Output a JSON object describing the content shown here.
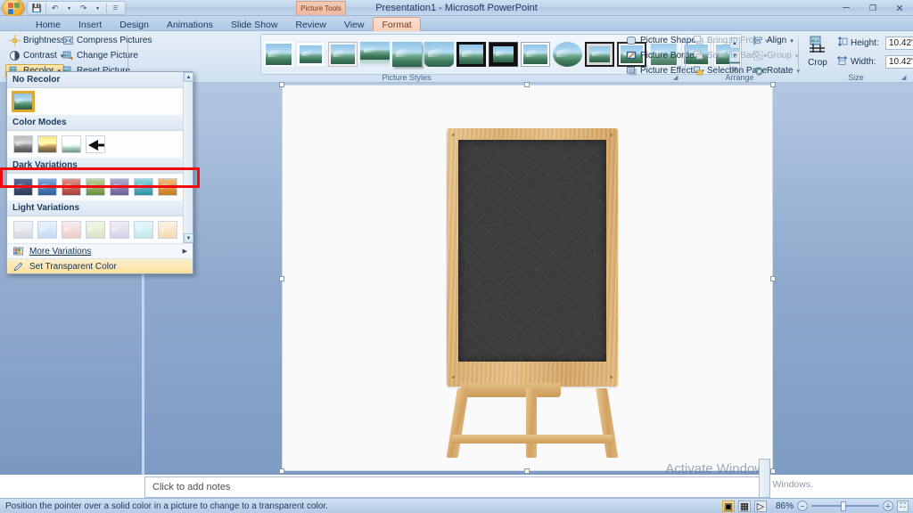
{
  "window": {
    "title": "Presentation1  -  Microsoft PowerPoint",
    "contextual_tab_banner": "Picture Tools",
    "minimize": "─",
    "restore": "❐",
    "close": "✕"
  },
  "quick_access": {
    "office_button": "office-orb",
    "items": [
      {
        "name": "save",
        "glyph": "💾"
      },
      {
        "name": "undo",
        "glyph": "↶"
      },
      {
        "name": "undo-dropdown",
        "glyph": "▾"
      },
      {
        "name": "redo",
        "glyph": "↷"
      },
      {
        "name": "redo-dropdown",
        "glyph": "▾"
      },
      {
        "name": "customize",
        "glyph": "☰"
      }
    ]
  },
  "tabs": [
    {
      "label": "Home",
      "active": false
    },
    {
      "label": "Insert",
      "active": false
    },
    {
      "label": "Design",
      "active": false
    },
    {
      "label": "Animations",
      "active": false
    },
    {
      "label": "Slide Show",
      "active": false
    },
    {
      "label": "Review",
      "active": false
    },
    {
      "label": "View",
      "active": false
    },
    {
      "label": "Format",
      "active": true
    }
  ],
  "ribbon": {
    "groups": [
      {
        "name": "adjust",
        "label": ""
      },
      {
        "name": "picture-styles",
        "label": "Picture Styles"
      },
      {
        "name": "arrange",
        "label": "Arrange"
      },
      {
        "name": "size",
        "label": "Size"
      }
    ],
    "adjust": {
      "brightness": "Brightness",
      "contrast": "Contrast",
      "recolor": "Recolor",
      "compress_pictures": "Compress Pictures",
      "change_picture": "Change Picture",
      "reset_picture": "Reset Picture"
    },
    "picture_styles": {
      "shape": "Picture Shape",
      "border": "Picture Border",
      "effects": "Picture Effects",
      "thumb_count": 15
    },
    "arrange": {
      "bring_to_front": "Bring to Front",
      "send_to_back": "Send to Back",
      "selection_pane": "Selection Pane",
      "align": "Align",
      "group": "Group",
      "rotate": "Rotate"
    },
    "size": {
      "crop": "Crop",
      "height_label": "Height:",
      "height_value": "10.42\"",
      "width_label": "Width:",
      "width_value": "10.42\""
    }
  },
  "recolor_menu": {
    "sections": [
      {
        "heading": "No Recolor",
        "swatches": 1,
        "selected_index": 0,
        "kind": "none"
      },
      {
        "heading": "Color Modes",
        "swatches": 4,
        "selected_index": -1,
        "kind": "modes"
      },
      {
        "heading": "Dark Variations",
        "swatches": 7,
        "selected_index": -1,
        "kind": "dark"
      },
      {
        "heading": "Light Variations",
        "swatches": 7,
        "selected_index": -1,
        "kind": "light"
      }
    ],
    "more_variations": "More Variations",
    "set_transparent_color": "Set Transparent Color",
    "highlighted_item": "Set Transparent Color",
    "annotation_color": "#f10a0a",
    "dark_colors": [
      "#3d4f72",
      "#4a79ba",
      "#c4564f",
      "#8aa85a",
      "#8278ad",
      "#4ba9bd",
      "#d78f3c"
    ],
    "light_colors": [
      "#dfe2e8",
      "#cfe0f2",
      "#f0d4d2",
      "#e2ebd4",
      "#ded9ea",
      "#d2ecf1",
      "#f6e1c6"
    ]
  },
  "slide": {
    "image_alt": "chalkboard-easel",
    "selected": true
  },
  "notes": {
    "placeholder": "Click to add notes"
  },
  "watermark": {
    "line1": "Activate Windows",
    "line2": "Go to Settings to activate Windows."
  },
  "statusbar": {
    "message": "Position the pointer over a solid color in a picture to change to a transparent color.",
    "views": [
      {
        "name": "normal-view",
        "glyph": "▣",
        "active": true
      },
      {
        "name": "slide-sorter-view",
        "glyph": "▦",
        "active": false
      },
      {
        "name": "slide-show-view",
        "glyph": "▷",
        "active": false
      }
    ],
    "zoom_level": "86%",
    "zoom_out": "−",
    "zoom_in": "＋",
    "fit_to_window": "⛶"
  },
  "colors": {
    "accent": "#f10a0a",
    "highlight": "#f5cf72",
    "titlebar": "#bfd4ea",
    "board": "#3c3c3c",
    "wood": "#d9ae6e"
  }
}
